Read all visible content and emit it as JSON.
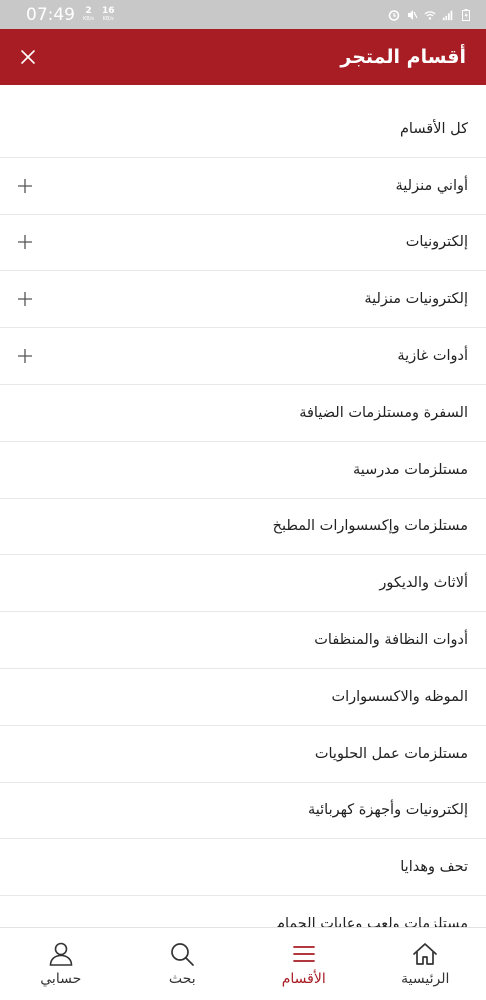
{
  "status_bar": {
    "time": "07:49",
    "speed_up": "2",
    "speed_down": "16",
    "speed_unit": "KB/s"
  },
  "header": {
    "title": "أقسام المتجر"
  },
  "categories": [
    {
      "label": "كل الأقسام",
      "expandable": false
    },
    {
      "label": "أواني منزلية",
      "expandable": true
    },
    {
      "label": "إلكترونيات",
      "expandable": true
    },
    {
      "label": "إلكترونيات منزلية",
      "expandable": true
    },
    {
      "label": "أدوات غازية",
      "expandable": true
    },
    {
      "label": "السفرة ومستلزمات الضيافة",
      "expandable": false
    },
    {
      "label": "مستلزمات مدرسية",
      "expandable": false
    },
    {
      "label": "مستلزمات وإكسسوارات المطبخ",
      "expandable": false
    },
    {
      "label": "ألاثاث والديكور",
      "expandable": false
    },
    {
      "label": "أدوات النظافة والمنظفات",
      "expandable": false
    },
    {
      "label": "الموظه والاكسسوارات",
      "expandable": false
    },
    {
      "label": "مستلزمات عمل الحلويات",
      "expandable": false
    },
    {
      "label": "إلكترونيات وأجهزة كهربائية",
      "expandable": false
    },
    {
      "label": "تحف وهدايا",
      "expandable": false
    },
    {
      "label": "مستلزمات ولعب وعابات الحمام",
      "expandable": false
    }
  ],
  "bottom_nav": {
    "account": "حسابي",
    "search": "بحث",
    "categories": "الأقسام",
    "home": "الرئيسية"
  },
  "colors": {
    "brand": "#a81c24",
    "status_bar": "#c8c8c8"
  }
}
